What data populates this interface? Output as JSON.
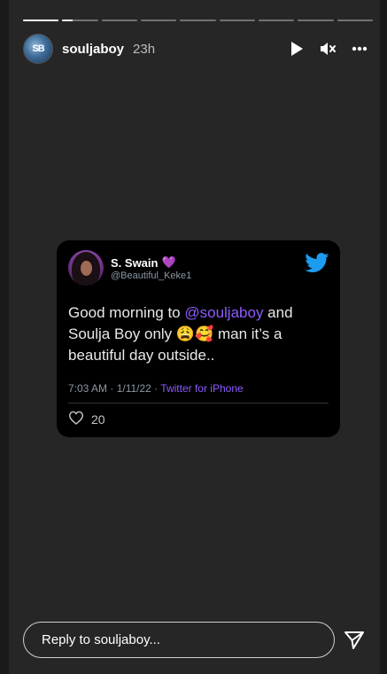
{
  "story": {
    "progress_segments": 9,
    "progress_first_fill": 1.0,
    "progress_second_fill": 0.3,
    "avatar_text": "SB",
    "username": "souljaboy",
    "time": "23h",
    "icons": {
      "play": "play-icon",
      "mute": "mute-icon",
      "more": "more-icon"
    }
  },
  "tweet": {
    "name": "S. Swain",
    "name_emoji": "💜",
    "handle": "@Beautiful_Keke1",
    "text_before": "Good morning to ",
    "mention": "@souljaboy",
    "text_after": " and Soulja Boy only 😩🥰 man it’s a beautiful day outside..",
    "meta": "7:03 AM · 1/11/22 · ",
    "source": "Twitter for iPhone",
    "likes": "20",
    "accent": "#8e5bff"
  },
  "reply": {
    "placeholder": "Reply to souljaboy..."
  }
}
